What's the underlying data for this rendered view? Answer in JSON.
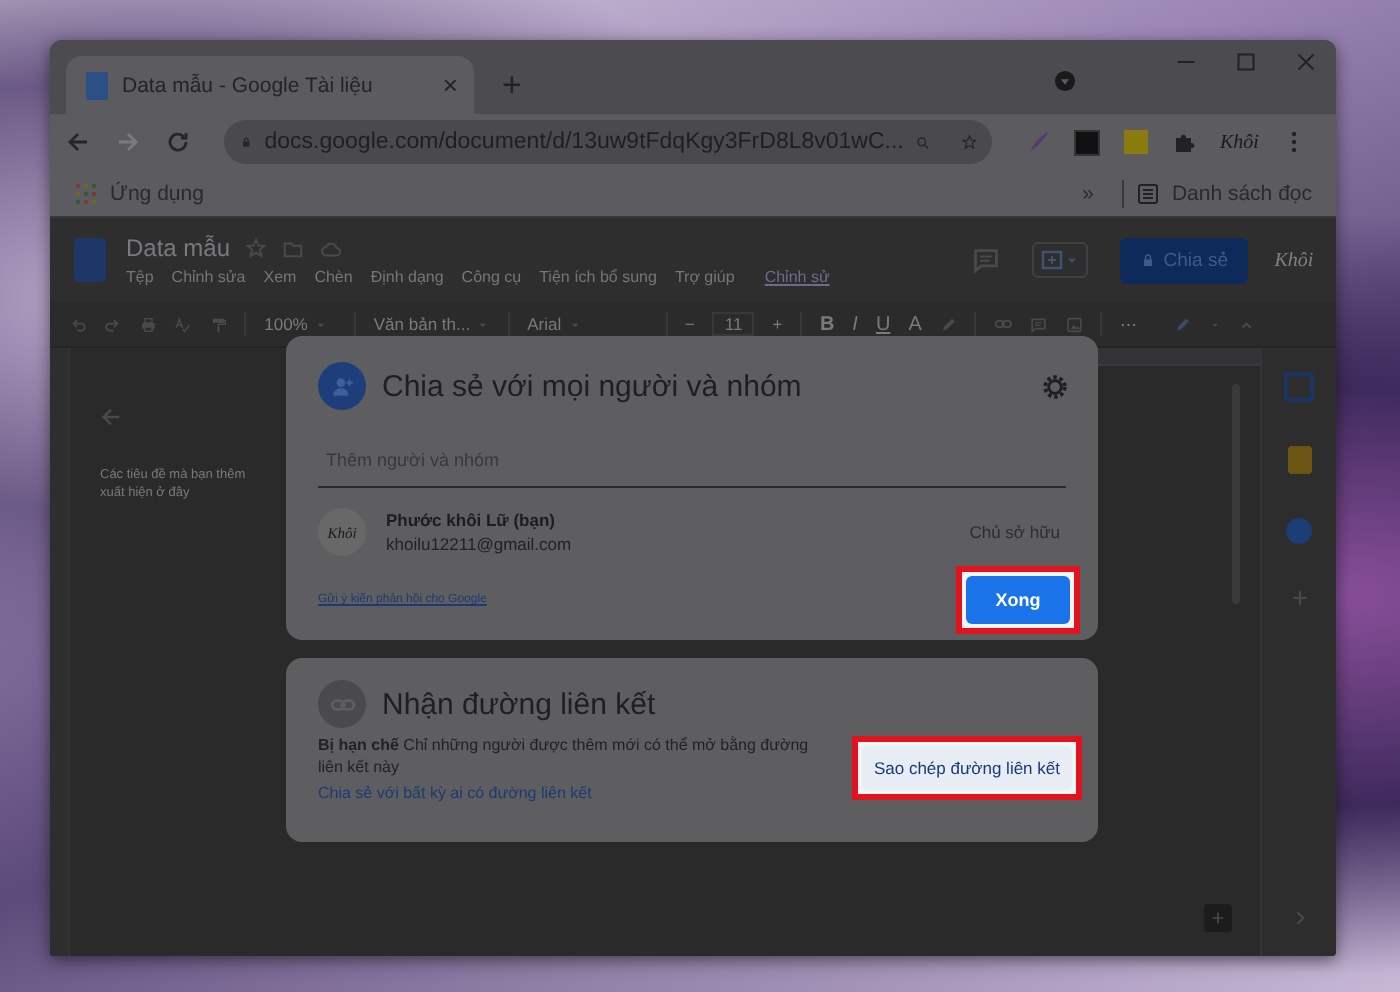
{
  "browser": {
    "tab": {
      "title": "Data mẫu - Google Tài liệu",
      "close": "×"
    },
    "new_tab": "+",
    "forward": {
      "disabled": true
    },
    "address": "docs.google.com/document/d/13uw9tFdqKgy3FrD8L8v01wC...",
    "profile_extension": "Khôi",
    "bookmarks": [
      {
        "label": "Ứng dụng"
      }
    ],
    "bookmarks_overflow": "»",
    "reading_list": "Danh sách đọc"
  },
  "doc": {
    "title": "Data mẫu",
    "menu": [
      {
        "label": "Tệp"
      },
      {
        "label": "Chỉnh sửa"
      },
      {
        "label": "Xem"
      },
      {
        "label": "Chèn"
      },
      {
        "label": "Định dạng"
      },
      {
        "label": "Công cụ"
      },
      {
        "label": "Tiện ích bổ sung"
      },
      {
        "label": "Trợ giúp"
      }
    ],
    "last_edit": "Chỉnh sử",
    "share_button": "Chia sẻ",
    "avatar": "Khôi",
    "toolbar": {
      "zoom": "100%",
      "style": "Văn bản th...",
      "font": "Arial",
      "size_minus": "−",
      "size": "11",
      "size_plus": "+",
      "bold": "B",
      "italic": "I",
      "underline": "U",
      "text_color": "A",
      "more": "⋯"
    },
    "outline": {
      "hint": "Các tiêu đề mà bạn thêm xuất hiện ở đây"
    }
  },
  "share_dialog": {
    "title": "Chia sẻ với mọi người và nhóm",
    "add_field": {
      "placeholder": "Thêm người và nhóm"
    },
    "people": [
      {
        "name": "Phước khôi Lữ (bạn)",
        "email": "khoilu12211@gmail.com",
        "role": "Chủ sở hữu",
        "avatar": "Khôi"
      }
    ],
    "feedback_link": "Gửi ý kiến phản hồi cho Google",
    "done_button": {
      "label": "Xong",
      "highlighted": true
    }
  },
  "link_dialog": {
    "title": "Nhận đường liên kết",
    "access": "**Bị hạn chế** Chỉ những người được thêm mới có thể mở bằng đường liên kết này",
    "change_link": "Chia sẻ với bất kỳ ai có đường liên kết",
    "copy_button": {
      "label": "Sao chép đường liên kết",
      "highlighted": true
    }
  }
}
